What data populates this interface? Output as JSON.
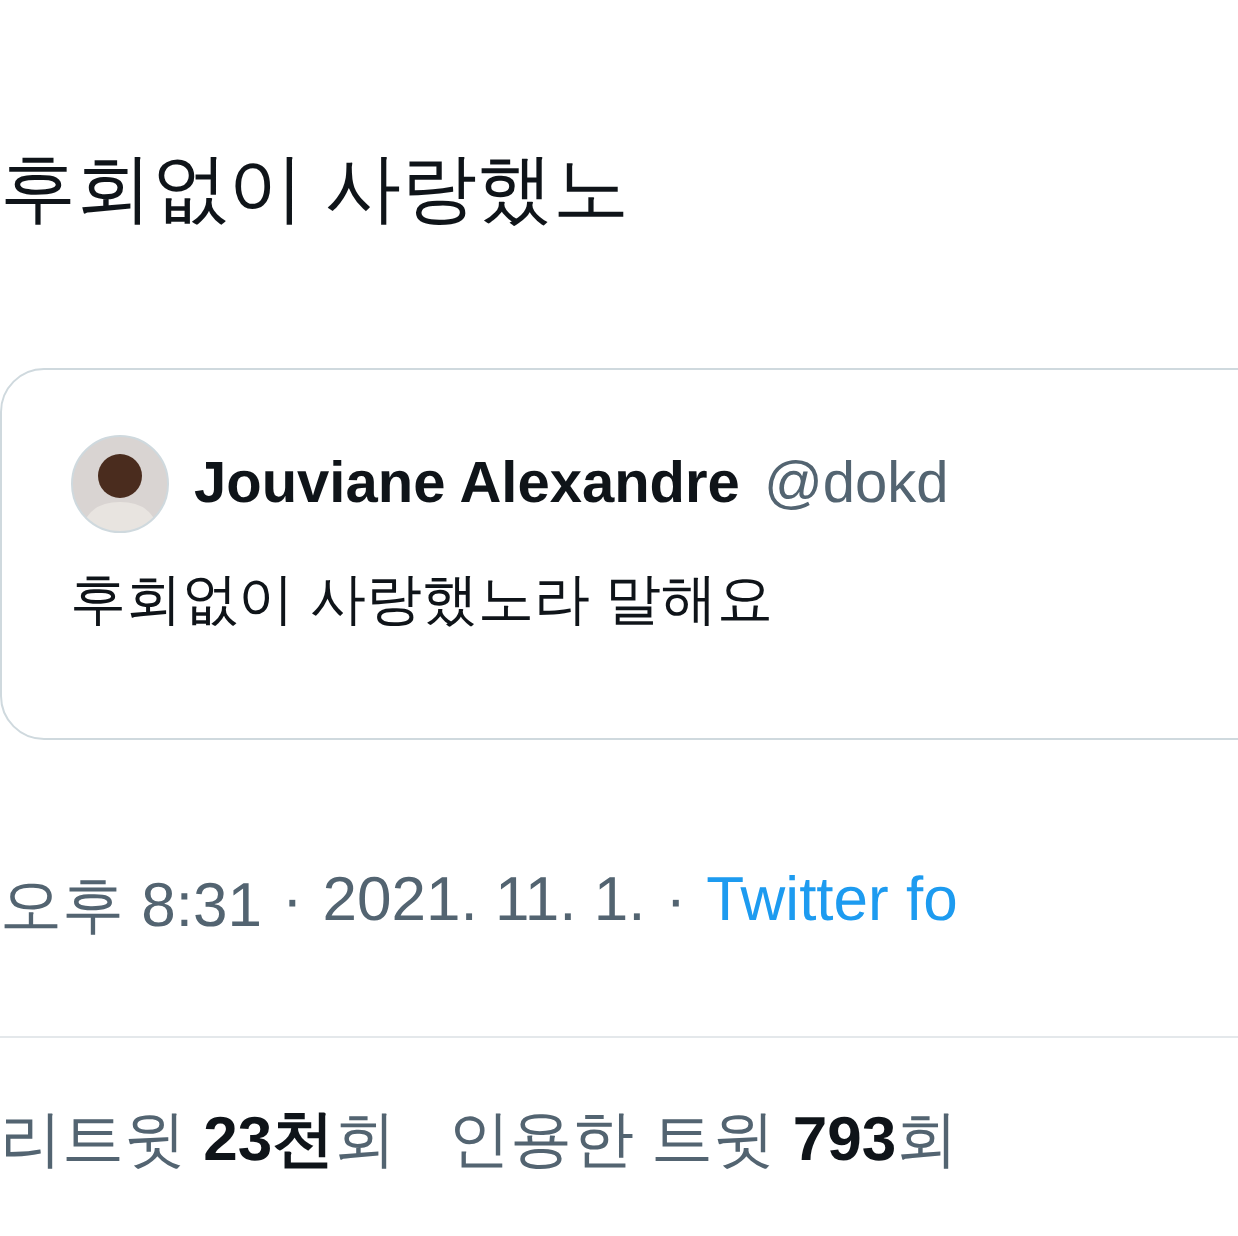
{
  "tweet": {
    "text": "후회없이 사랑했노"
  },
  "quoted_tweet": {
    "name": "Jouviane Alexandre",
    "handle": "@dokd",
    "text": "후회없이 사랑했노라 말해요"
  },
  "meta": {
    "time": "오후 8:31",
    "separator": "·",
    "date": "2021. 11. 1.",
    "source": "Twitter fo"
  },
  "stats": [
    {
      "text": "리트윗 **23천**회"
    },
    {
      "text": "인용한 트윗 **793**회"
    }
  ]
}
